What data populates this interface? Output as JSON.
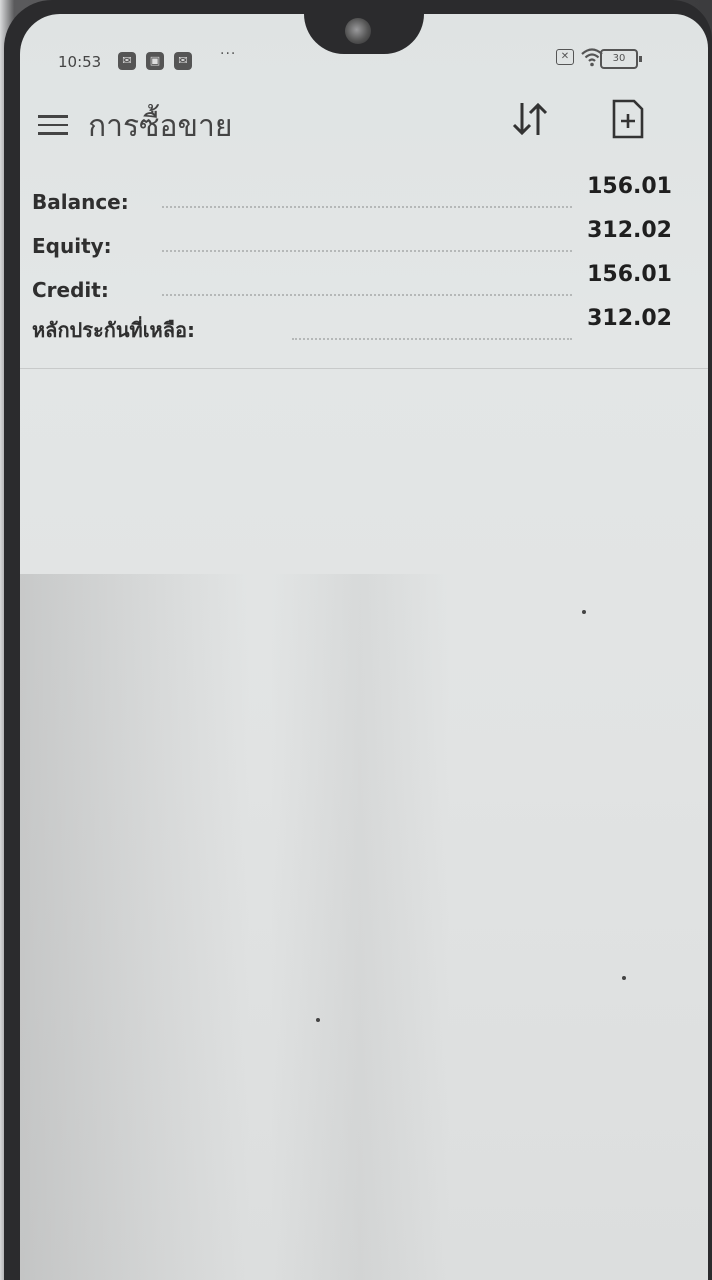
{
  "status_bar": {
    "time": "10:53",
    "battery": "30"
  },
  "app_bar": {
    "title": "การซื้อขาย"
  },
  "account": [
    {
      "label": "Balance:",
      "value": "156.01"
    },
    {
      "label": "Equity:",
      "value": "312.02"
    },
    {
      "label": "Credit:",
      "value": "156.01"
    },
    {
      "label": "หลักประกันที่เหลือ:",
      "value": "312.02"
    }
  ],
  "icons": {
    "menu": "hamburger-menu-icon",
    "sort": "sort-arrows-icon",
    "add": "add-order-icon"
  }
}
